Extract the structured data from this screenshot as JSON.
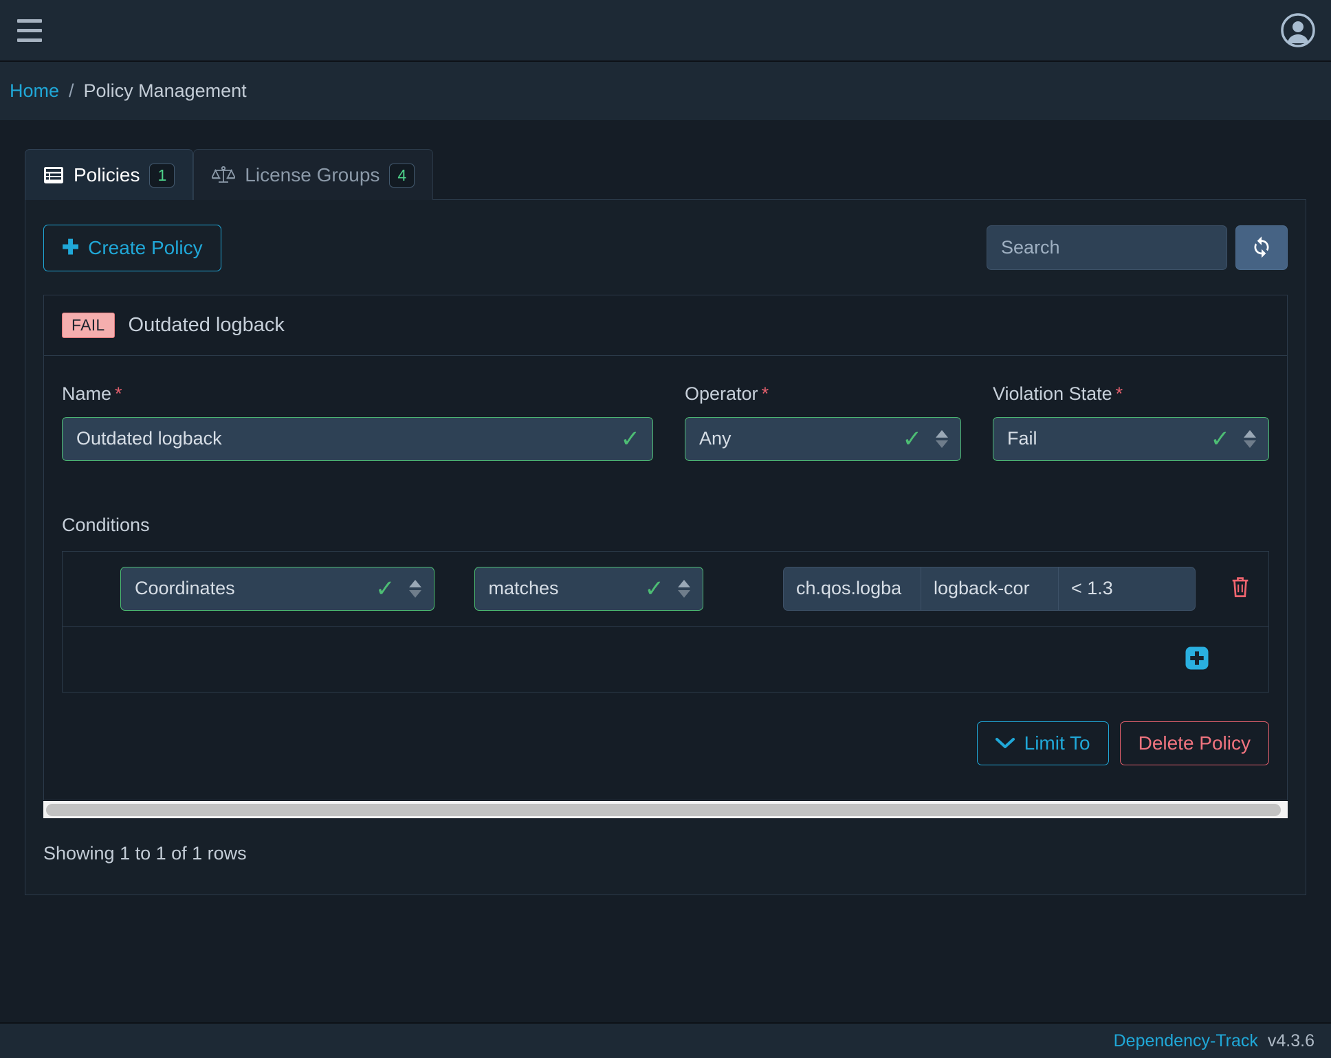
{
  "navbar": {
    "menu_icon": "hamburger-menu-icon",
    "avatar_icon": "user-avatar-icon"
  },
  "breadcrumb": {
    "home_label": "Home",
    "separator": "/",
    "current_label": "Policy Management"
  },
  "tabs": [
    {
      "label": "Policies",
      "badge": "1",
      "icon": "list-table-icon",
      "active": true
    },
    {
      "label": "License Groups",
      "badge": "4",
      "icon": "balance-scales-icon",
      "active": false
    }
  ],
  "toolbar": {
    "create_label": "Create Policy",
    "create_icon": "plus-icon",
    "search_placeholder": "Search",
    "search_value": "",
    "refresh_icon": "refresh-sync-icon"
  },
  "policy": {
    "status_badge": "FAIL",
    "title": "Outdated logback",
    "name": {
      "label": "Name",
      "required_marker": "*",
      "value": "Outdated logback"
    },
    "operator": {
      "label": "Operator",
      "required_marker": "*",
      "value": "Any"
    },
    "violation_state": {
      "label": "Violation State",
      "required_marker": "*",
      "value": "Fail"
    },
    "conditions_label": "Conditions",
    "conditions": [
      {
        "subject": "Coordinates",
        "operator": "matches",
        "group": "ch.qos.logba",
        "name": "logback-cor",
        "version": "< 1.3",
        "delete_icon": "trash-icon"
      }
    ],
    "add_condition_icon": "plus-square-icon",
    "limit_to_label": "Limit To",
    "limit_to_icon": "chevron-down-icon",
    "delete_policy_label": "Delete Policy"
  },
  "table": {
    "rows_info": "Showing 1 to 1 of 1 rows"
  },
  "footer": {
    "brand": "Dependency-Track",
    "version": "v4.3.6"
  },
  "colors": {
    "accent_blue": "#20a8d8",
    "valid_green": "#4dbd74",
    "danger_red": "#e4606d",
    "fail_badge_bg": "#f5aeae",
    "page_bg": "#151d26",
    "navbar_bg": "#1d2935"
  }
}
